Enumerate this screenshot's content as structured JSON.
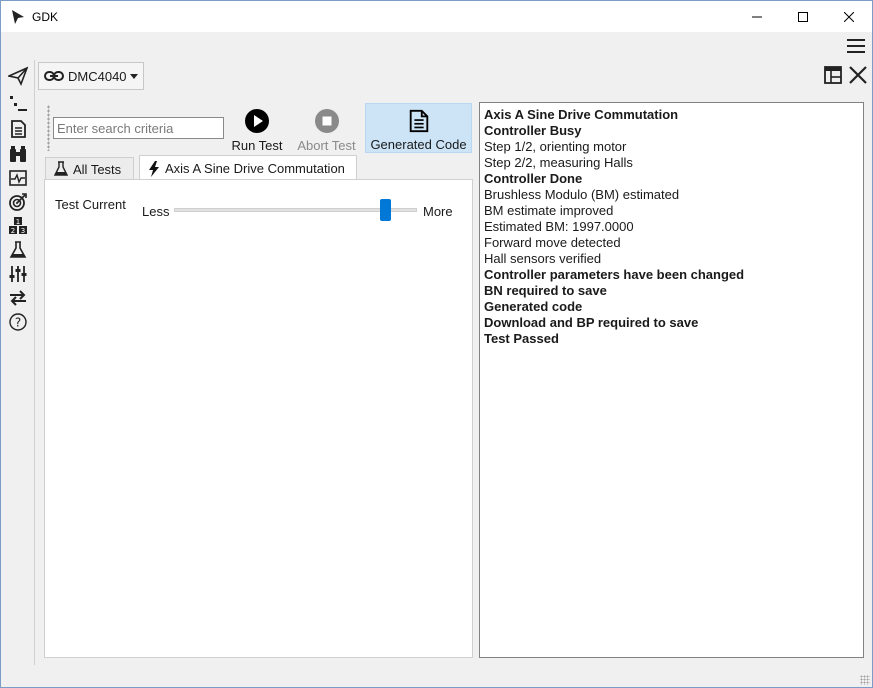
{
  "window": {
    "title": "GDK"
  },
  "connection": {
    "selected": "DMC4040"
  },
  "toolbar": {
    "search_placeholder": "Enter search criteria",
    "run_label": "Run Test",
    "abort_label": "Abort Test",
    "generated_label": "Generated Code"
  },
  "tabs": [
    {
      "label": "All Tests",
      "icon": "flask-icon"
    },
    {
      "label": "Axis A Sine Drive Commutation",
      "icon": "lightning-icon"
    }
  ],
  "test_page": {
    "current_label": "Test Current",
    "less_label": "Less",
    "more_label": "More",
    "slider_fraction": 0.87
  },
  "log": [
    {
      "text": "Axis A Sine Drive Commutation",
      "bold": true
    },
    {
      "text": "Controller Busy",
      "bold": true
    },
    {
      "text": "Step 1/2, orienting motor",
      "bold": false
    },
    {
      "text": "Step 2/2, measuring Halls",
      "bold": false
    },
    {
      "text": "Controller Done",
      "bold": true
    },
    {
      "text": "Brushless Modulo (BM) estimated",
      "bold": false
    },
    {
      "text": "BM estimate improved",
      "bold": false
    },
    {
      "text": "Estimated BM: 1997.0000",
      "bold": false
    },
    {
      "text": "Forward move detected",
      "bold": false
    },
    {
      "text": "Hall sensors verified",
      "bold": false
    },
    {
      "text": "Controller parameters have been changed",
      "bold": true
    },
    {
      "text": "BN required to save",
      "bold": true
    },
    {
      "text": "Generated code",
      "bold": true
    },
    {
      "text": "Download and BP required to save",
      "bold": true
    },
    {
      "text": "Test Passed",
      "bold": true
    }
  ],
  "sidebar_icons": [
    "paper-plane-icon",
    "tree-list-icon",
    "document-icon",
    "binoculars-icon",
    "scope-icon",
    "target-icon",
    "numbered-blocks-icon",
    "flask-icon",
    "sliders-icon",
    "transfer-arrows-icon",
    "help-icon"
  ],
  "colors": {
    "accent": "#0078d7",
    "selected_button": "#cde4f7"
  }
}
